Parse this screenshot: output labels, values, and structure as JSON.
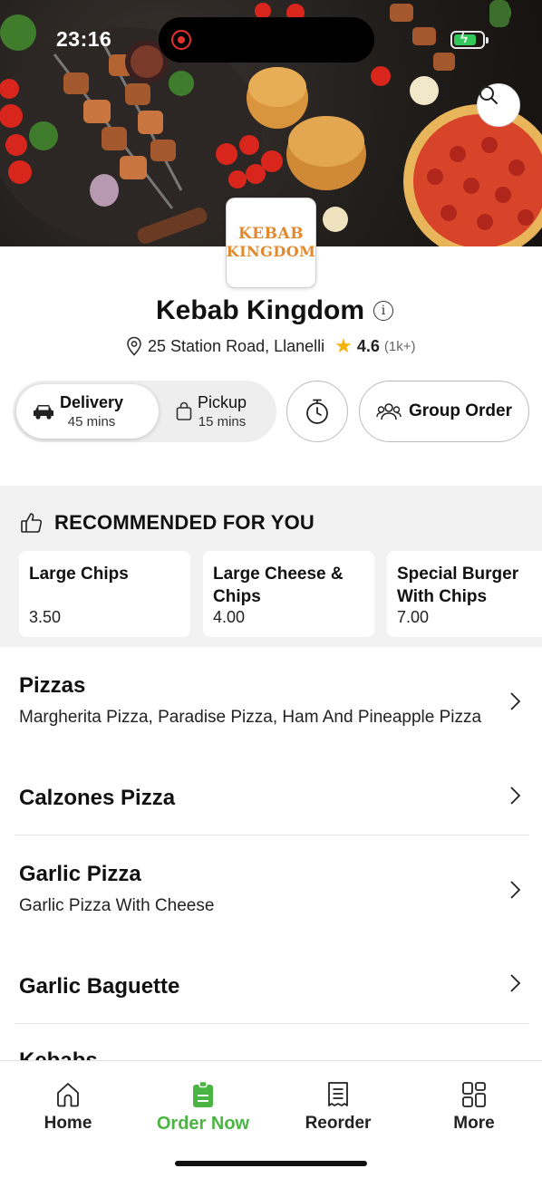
{
  "status_bar": {
    "time": "23:16"
  },
  "store": {
    "logo_line1": "KEBAB",
    "logo_line2": "KINGDOM",
    "name": "Kebab Kingdom",
    "address": "25 Station Road, Llanelli",
    "rating": "4.6",
    "rating_count": "(1k+)"
  },
  "order_mode": {
    "delivery": {
      "label": "Delivery",
      "time": "45 mins",
      "selected": true
    },
    "pickup": {
      "label": "Pickup",
      "time": "15 mins",
      "selected": false
    },
    "group_order_label": "Group Order"
  },
  "recommended": {
    "heading": "RECOMMENDED FOR YOU",
    "items": [
      {
        "name": "Large Chips",
        "price": "3.50"
      },
      {
        "name": "Large Cheese & Chips",
        "price": "4.00"
      },
      {
        "name": "Special Burger With Chips",
        "price": "7.00"
      }
    ]
  },
  "categories": [
    {
      "title": "Pizzas",
      "subtitle": "Margherita Pizza, Paradise Pizza, Ham And Pineapple Pizza"
    },
    {
      "title": "Calzones Pizza",
      "subtitle": ""
    },
    {
      "title": "Garlic Pizza",
      "subtitle": "Garlic Pizza With Cheese"
    },
    {
      "title": "Garlic Baguette",
      "subtitle": ""
    },
    {
      "title": "Kebabs",
      "subtitle": ""
    }
  ],
  "tab_bar": {
    "active": "Order Now",
    "tabs": [
      {
        "label": "Home",
        "icon": "home-icon"
      },
      {
        "label": "Order Now",
        "icon": "order-bag-icon"
      },
      {
        "label": "Reorder",
        "icon": "receipt-icon"
      },
      {
        "label": "More",
        "icon": "grid-icon"
      }
    ]
  },
  "colors": {
    "accent_green": "#4bb543",
    "star": "#f5b301",
    "logo_orange": "#e2892d"
  }
}
